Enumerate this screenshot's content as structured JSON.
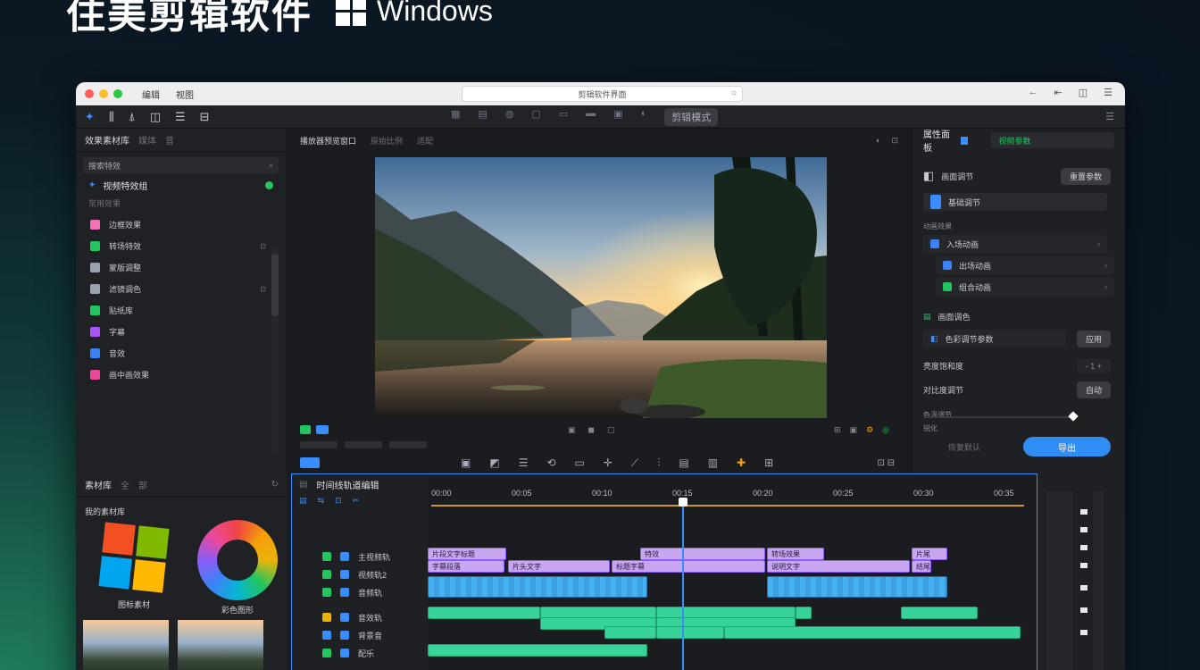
{
  "headline": {
    "title": "住美剪辑软件",
    "platform": "Windows"
  },
  "window": {
    "menu": [
      "编辑",
      "视图"
    ],
    "url": "剪辑软件界面",
    "tb_right": [
      "←",
      "⇤",
      "◫",
      "☰"
    ]
  },
  "toolbar": {
    "left_icons": [
      "✦",
      "⫼",
      "⍋",
      "◫",
      "☰",
      "⊟"
    ],
    "center_icons": [
      "▦",
      "▤",
      "◍",
      "▢",
      "▭",
      "▬",
      "▣",
      "◐"
    ],
    "center_pill": "剪辑模式",
    "right_icon": "☰"
  },
  "media": {
    "title": "效果素材库",
    "tabs": [
      "媒体",
      "音"
    ],
    "search": "搜索特效",
    "effect_header": "视频特效组",
    "sub_label": "常用效果",
    "items": [
      {
        "label": "边框效果",
        "color": "#f472b6"
      },
      {
        "label": "转场特效",
        "color": "#22c55e"
      },
      {
        "label": "蒙版调整",
        "color": "#9ca3af"
      },
      {
        "label": "滤镜调色",
        "color": "#9ca3af"
      },
      {
        "label": "贴纸库",
        "color": "#22c55e"
      },
      {
        "label": "字幕",
        "color": "#a855f7"
      },
      {
        "label": "音效",
        "color": "#3b82f6"
      },
      {
        "label": "画中画效果",
        "color": "#ec4899"
      }
    ]
  },
  "viewer": {
    "title": "播放器预览窗口",
    "tabs": [
      "原始比例",
      "适配"
    ],
    "right": [
      "◐",
      "⊡"
    ],
    "controls_mid": [
      "▣",
      "◼",
      "▢"
    ],
    "controls_right": [
      "⊞",
      "▣",
      "⚙",
      "◎"
    ],
    "edit_right": "⊡ ⊟"
  },
  "inspector": {
    "title": "属性面板",
    "field": "视频参数",
    "section1": "画面调节",
    "section1_btn": "重置参数",
    "field2": "基础调节",
    "list_label": "动画效果",
    "list": [
      {
        "label": "入场动画",
        "color": "#3b82f6"
      },
      {
        "label": "出场动画",
        "color": "#3b82f6"
      },
      {
        "label": "组合动画",
        "color": "#22c55e"
      }
    ],
    "section2": "画面调色",
    "field3": "色彩调节参数",
    "field3_btn": "应用",
    "row_a": "亮度饱和度",
    "row_a_val": "- 1 +",
    "row_b": "对比度调节",
    "row_b_btn": "自动",
    "row_c": "色温调节",
    "row_d": "锐化",
    "row_reset": "恢复默认",
    "apply": "导出"
  },
  "assets": {
    "title": "素材库",
    "tabs": [
      "全",
      "部"
    ],
    "sub": "我的素材库",
    "tile1": "图标素材",
    "tile2": "彩色图形"
  },
  "timeline": {
    "title": "时间线轨道编辑",
    "ruler": [
      "00:00",
      "00:05",
      "00:10",
      "00:15",
      "00:20",
      "00:25",
      "00:30",
      "00:35"
    ],
    "tracks": [
      "主视频轨",
      "视频轨2",
      "音频轨",
      "音效轨",
      "背景音",
      "配乐"
    ],
    "clips_p1": [
      "片段文字标题",
      "特效",
      "转场效果",
      "片尾"
    ],
    "clips_p2": [
      "字幕段落",
      "片头文字",
      "标题字幕",
      "说明文字",
      "结尾字幕"
    ]
  },
  "colors": {
    "accent": "#3a8dff",
    "green": "#22c55e",
    "purple": "#c9a6f2",
    "teal": "#37d39a"
  }
}
